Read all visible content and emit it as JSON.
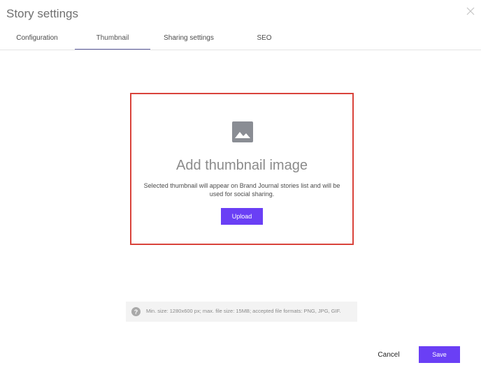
{
  "dialog": {
    "title": "Story settings"
  },
  "tabs": [
    {
      "label": "Configuration",
      "active": false
    },
    {
      "label": "Thumbnail",
      "active": true
    },
    {
      "label": "Sharing settings",
      "active": false
    },
    {
      "label": "SEO",
      "active": false
    }
  ],
  "dropzone": {
    "icon": "image-icon",
    "heading": "Add thumbnail image",
    "description": "Selected thumbnail will appear on Brand Journal stories list and will be used for social sharing.",
    "upload_label": "Upload"
  },
  "hint": {
    "icon": "question-circle-icon",
    "text": "Min. size: 1280x600 px; max. file size: 15MB; accepted file formats: PNG, JPG, GIF."
  },
  "footer": {
    "cancel_label": "Cancel",
    "save_label": "Save"
  },
  "colors": {
    "accent": "#6a3ff5",
    "highlight_border": "#d9433b",
    "active_tab_underline": "#5c5b9d"
  }
}
